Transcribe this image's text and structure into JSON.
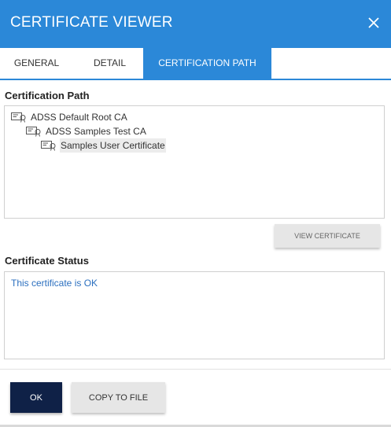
{
  "dialog": {
    "title": "CERTIFICATE VIEWER",
    "accent_color": "#2b88d8"
  },
  "tabs": [
    {
      "label": "GENERAL",
      "active": false
    },
    {
      "label": "DETAIL",
      "active": false
    },
    {
      "label": "CERTIFICATION PATH",
      "active": true
    }
  ],
  "certification_path": {
    "heading": "Certification Path",
    "nodes": [
      {
        "label": "ADSS Default Root CA",
        "icon": "certificate-icon"
      },
      {
        "label": "ADSS Samples Test CA",
        "icon": "certificate-icon"
      },
      {
        "label": "Samples User Certificate",
        "icon": "certificate-icon",
        "selected": true
      }
    ],
    "view_button_label": "VIEW CERTIFICATE"
  },
  "certificate_status": {
    "heading": "Certificate Status",
    "text": "This certificate is OK",
    "text_color": "#2b6fbf"
  },
  "footer": {
    "ok_label": "OK",
    "copy_label": "COPY TO FILE"
  }
}
